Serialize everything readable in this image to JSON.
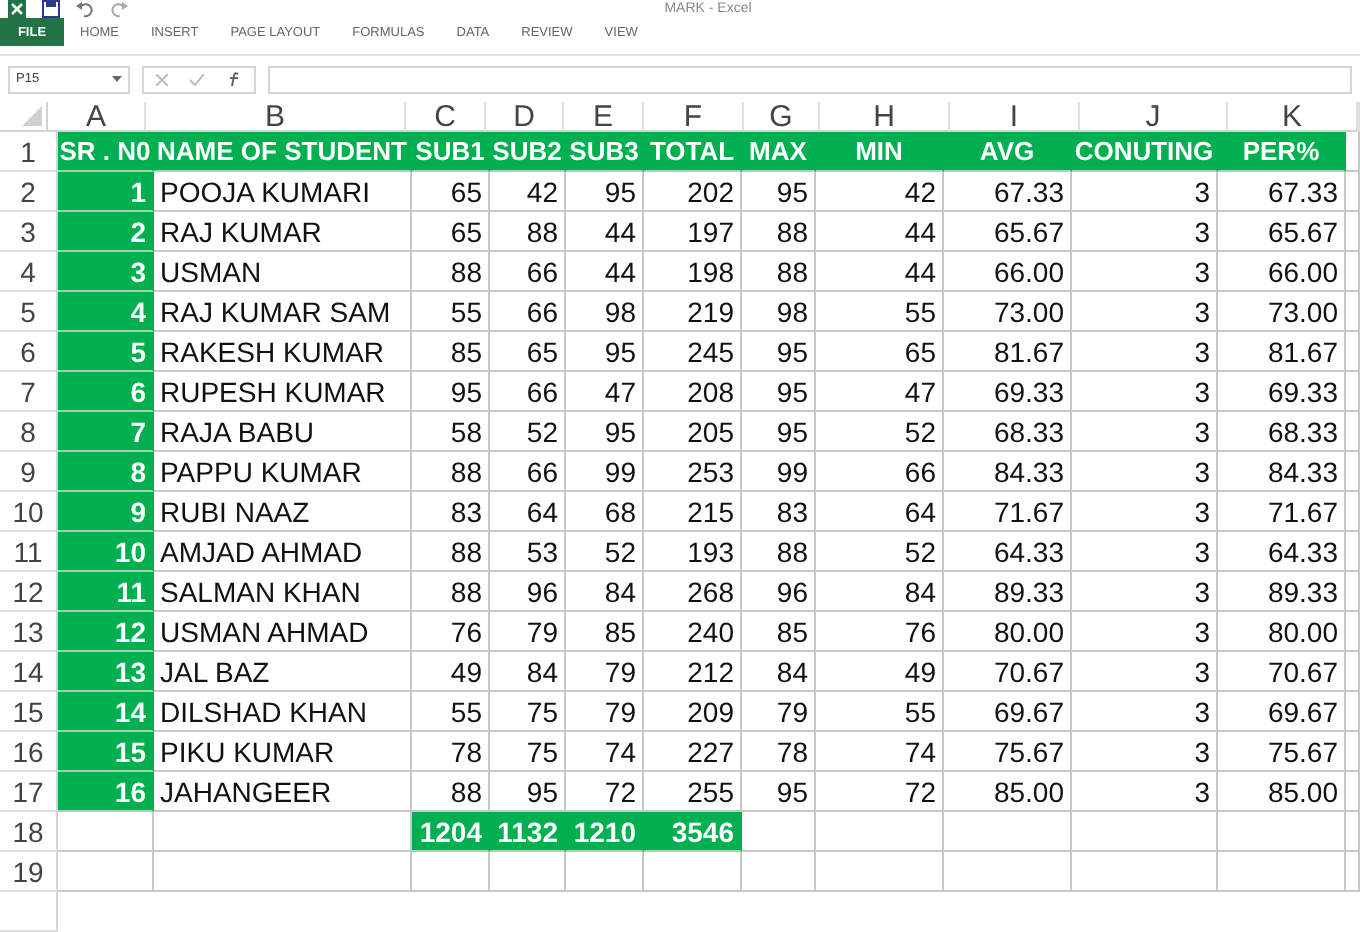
{
  "window": {
    "title": "MARK - Excel"
  },
  "file_tab": "FILE",
  "tabs": [
    {
      "label": "HOME",
      "selected": false
    },
    {
      "label": "INSERT",
      "selected": false
    },
    {
      "label": "PAGE LAYOUT",
      "selected": false
    },
    {
      "label": "FORMULAS",
      "selected": false
    },
    {
      "label": "DATA",
      "selected": false
    },
    {
      "label": "REVIEW",
      "selected": false
    },
    {
      "label": "VIEW",
      "selected": false
    }
  ],
  "name_box": "P15",
  "columns": [
    "A",
    "B",
    "C",
    "D",
    "E",
    "F",
    "G",
    "H",
    "I",
    "J",
    "K"
  ],
  "rows": [
    {
      "number": "1",
      "kind": "header",
      "cells": [
        "SR . N0",
        "NAME OF STUDENT",
        "SUB1",
        "SUB2",
        "SUB3",
        "TOTAL",
        "MAX",
        "MIN",
        "AVG",
        "CONUTING",
        "PER%"
      ]
    },
    {
      "number": "2",
      "kind": "student",
      "cells": [
        "1",
        "POOJA KUMARI",
        "65",
        "42",
        "95",
        "202",
        "95",
        "42",
        "67.33",
        "3",
        "67.33"
      ]
    },
    {
      "number": "3",
      "kind": "student",
      "cells": [
        "2",
        "RAJ KUMAR",
        "65",
        "88",
        "44",
        "197",
        "88",
        "44",
        "65.67",
        "3",
        "65.67"
      ]
    },
    {
      "number": "4",
      "kind": "student",
      "cells": [
        "3",
        "USMAN",
        "88",
        "66",
        "44",
        "198",
        "88",
        "44",
        "66.00",
        "3",
        "66.00"
      ]
    },
    {
      "number": "5",
      "kind": "student",
      "cells": [
        "4",
        "RAJ KUMAR SAM",
        "55",
        "66",
        "98",
        "219",
        "98",
        "55",
        "73.00",
        "3",
        "73.00"
      ]
    },
    {
      "number": "6",
      "kind": "student",
      "cells": [
        "5",
        "RAKESH KUMAR",
        "85",
        "65",
        "95",
        "245",
        "95",
        "65",
        "81.67",
        "3",
        "81.67"
      ]
    },
    {
      "number": "7",
      "kind": "student",
      "cells": [
        "6",
        "RUPESH KUMAR",
        "95",
        "66",
        "47",
        "208",
        "95",
        "47",
        "69.33",
        "3",
        "69.33"
      ]
    },
    {
      "number": "8",
      "kind": "student",
      "cells": [
        "7",
        "RAJA BABU",
        "58",
        "52",
        "95",
        "205",
        "95",
        "52",
        "68.33",
        "3",
        "68.33"
      ]
    },
    {
      "number": "9",
      "kind": "student",
      "cells": [
        "8",
        "PAPPU KUMAR",
        "88",
        "66",
        "99",
        "253",
        "99",
        "66",
        "84.33",
        "3",
        "84.33"
      ]
    },
    {
      "number": "10",
      "kind": "student",
      "cells": [
        "9",
        "RUBI NAAZ",
        "83",
        "64",
        "68",
        "215",
        "83",
        "64",
        "71.67",
        "3",
        "71.67"
      ]
    },
    {
      "number": "11",
      "kind": "student",
      "cells": [
        "10",
        "AMJAD AHMAD",
        "88",
        "53",
        "52",
        "193",
        "88",
        "52",
        "64.33",
        "3",
        "64.33"
      ]
    },
    {
      "number": "12",
      "kind": "student",
      "cells": [
        "11",
        "SALMAN KHAN",
        "88",
        "96",
        "84",
        "268",
        "96",
        "84",
        "89.33",
        "3",
        "89.33"
      ]
    },
    {
      "number": "13",
      "kind": "student",
      "cells": [
        "12",
        "USMAN AHMAD",
        "76",
        "79",
        "85",
        "240",
        "85",
        "76",
        "80.00",
        "3",
        "80.00"
      ]
    },
    {
      "number": "14",
      "kind": "student",
      "cells": [
        "13",
        "JAL BAZ",
        "49",
        "84",
        "79",
        "212",
        "84",
        "49",
        "70.67",
        "3",
        "70.67"
      ]
    },
    {
      "number": "15",
      "kind": "student",
      "cells": [
        "14",
        "DILSHAD KHAN",
        "55",
        "75",
        "79",
        "209",
        "79",
        "55",
        "69.67",
        "3",
        "69.67"
      ]
    },
    {
      "number": "16",
      "kind": "student",
      "cells": [
        "15",
        "PIKU KUMAR",
        "78",
        "75",
        "74",
        "227",
        "78",
        "74",
        "75.67",
        "3",
        "75.67"
      ]
    },
    {
      "number": "17",
      "kind": "student",
      "cells": [
        "16",
        "JAHANGEER",
        "88",
        "95",
        "72",
        "255",
        "95",
        "72",
        "85.00",
        "3",
        "85.00"
      ]
    },
    {
      "number": "18",
      "kind": "totals",
      "cells": [
        "",
        "",
        "1204",
        "1132",
        "1210",
        "3546",
        "",
        "",
        "",
        "",
        ""
      ]
    },
    {
      "number": "19",
      "kind": "empty",
      "cells": [
        "",
        "",
        "",
        "",
        "",
        "",
        "",
        "",
        "",
        "",
        ""
      ]
    }
  ]
}
